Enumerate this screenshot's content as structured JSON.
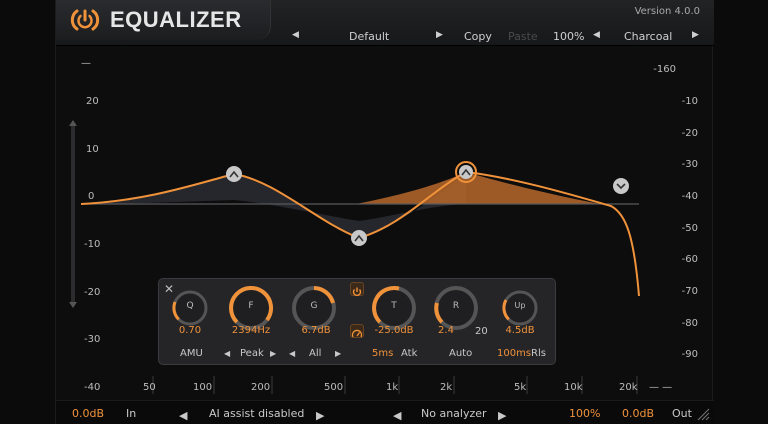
{
  "header": {
    "title": "EQUALIZER",
    "version": "Version 4.0.0",
    "preset": "Default",
    "copy": "Copy",
    "paste": "Paste",
    "zoom": "100%",
    "theme": "Charcoal"
  },
  "plot": {
    "left_scale": [
      "20",
      "10",
      "0",
      "-10",
      "-20",
      "-30",
      "-40"
    ],
    "right_scale": [
      "-160",
      "-10",
      "-20",
      "-30",
      "-40",
      "-50",
      "-60",
      "-70",
      "-80",
      "-90"
    ],
    "freq_labels": [
      "50",
      "100",
      "200",
      "500",
      "1k",
      "2k",
      "5k",
      "10k",
      "20k"
    ],
    "dash_left": "—",
    "dash_right": "— —"
  },
  "band": {
    "q_label": "Q",
    "q_value": "0.70",
    "f_label": "F",
    "f_value": "2394Hz",
    "g_label": "G",
    "g_value": "6.7dB",
    "t_label": "T",
    "t_value": "-25.0dB",
    "r_label": "R",
    "r_value": "2.4",
    "r_max": "20",
    "up_label": "Up",
    "up_value": "4.5dB",
    "mode": "AMU",
    "shape": "Peak",
    "channel": "All",
    "attack": "5ms",
    "attack_label": "Atk",
    "auto": "Auto",
    "release": "100ms",
    "release_label": "Rls"
  },
  "footer": {
    "in_gain": "0.0dB",
    "in_label": "In",
    "ai_assist": "AI assist disabled",
    "analyzer": "No analyzer",
    "mix": "100%",
    "out_gain": "0.0dB",
    "out_label": "Out"
  },
  "colors": {
    "accent": "#f0923a",
    "background": "#0d0d0e",
    "panel": "#26272a"
  }
}
